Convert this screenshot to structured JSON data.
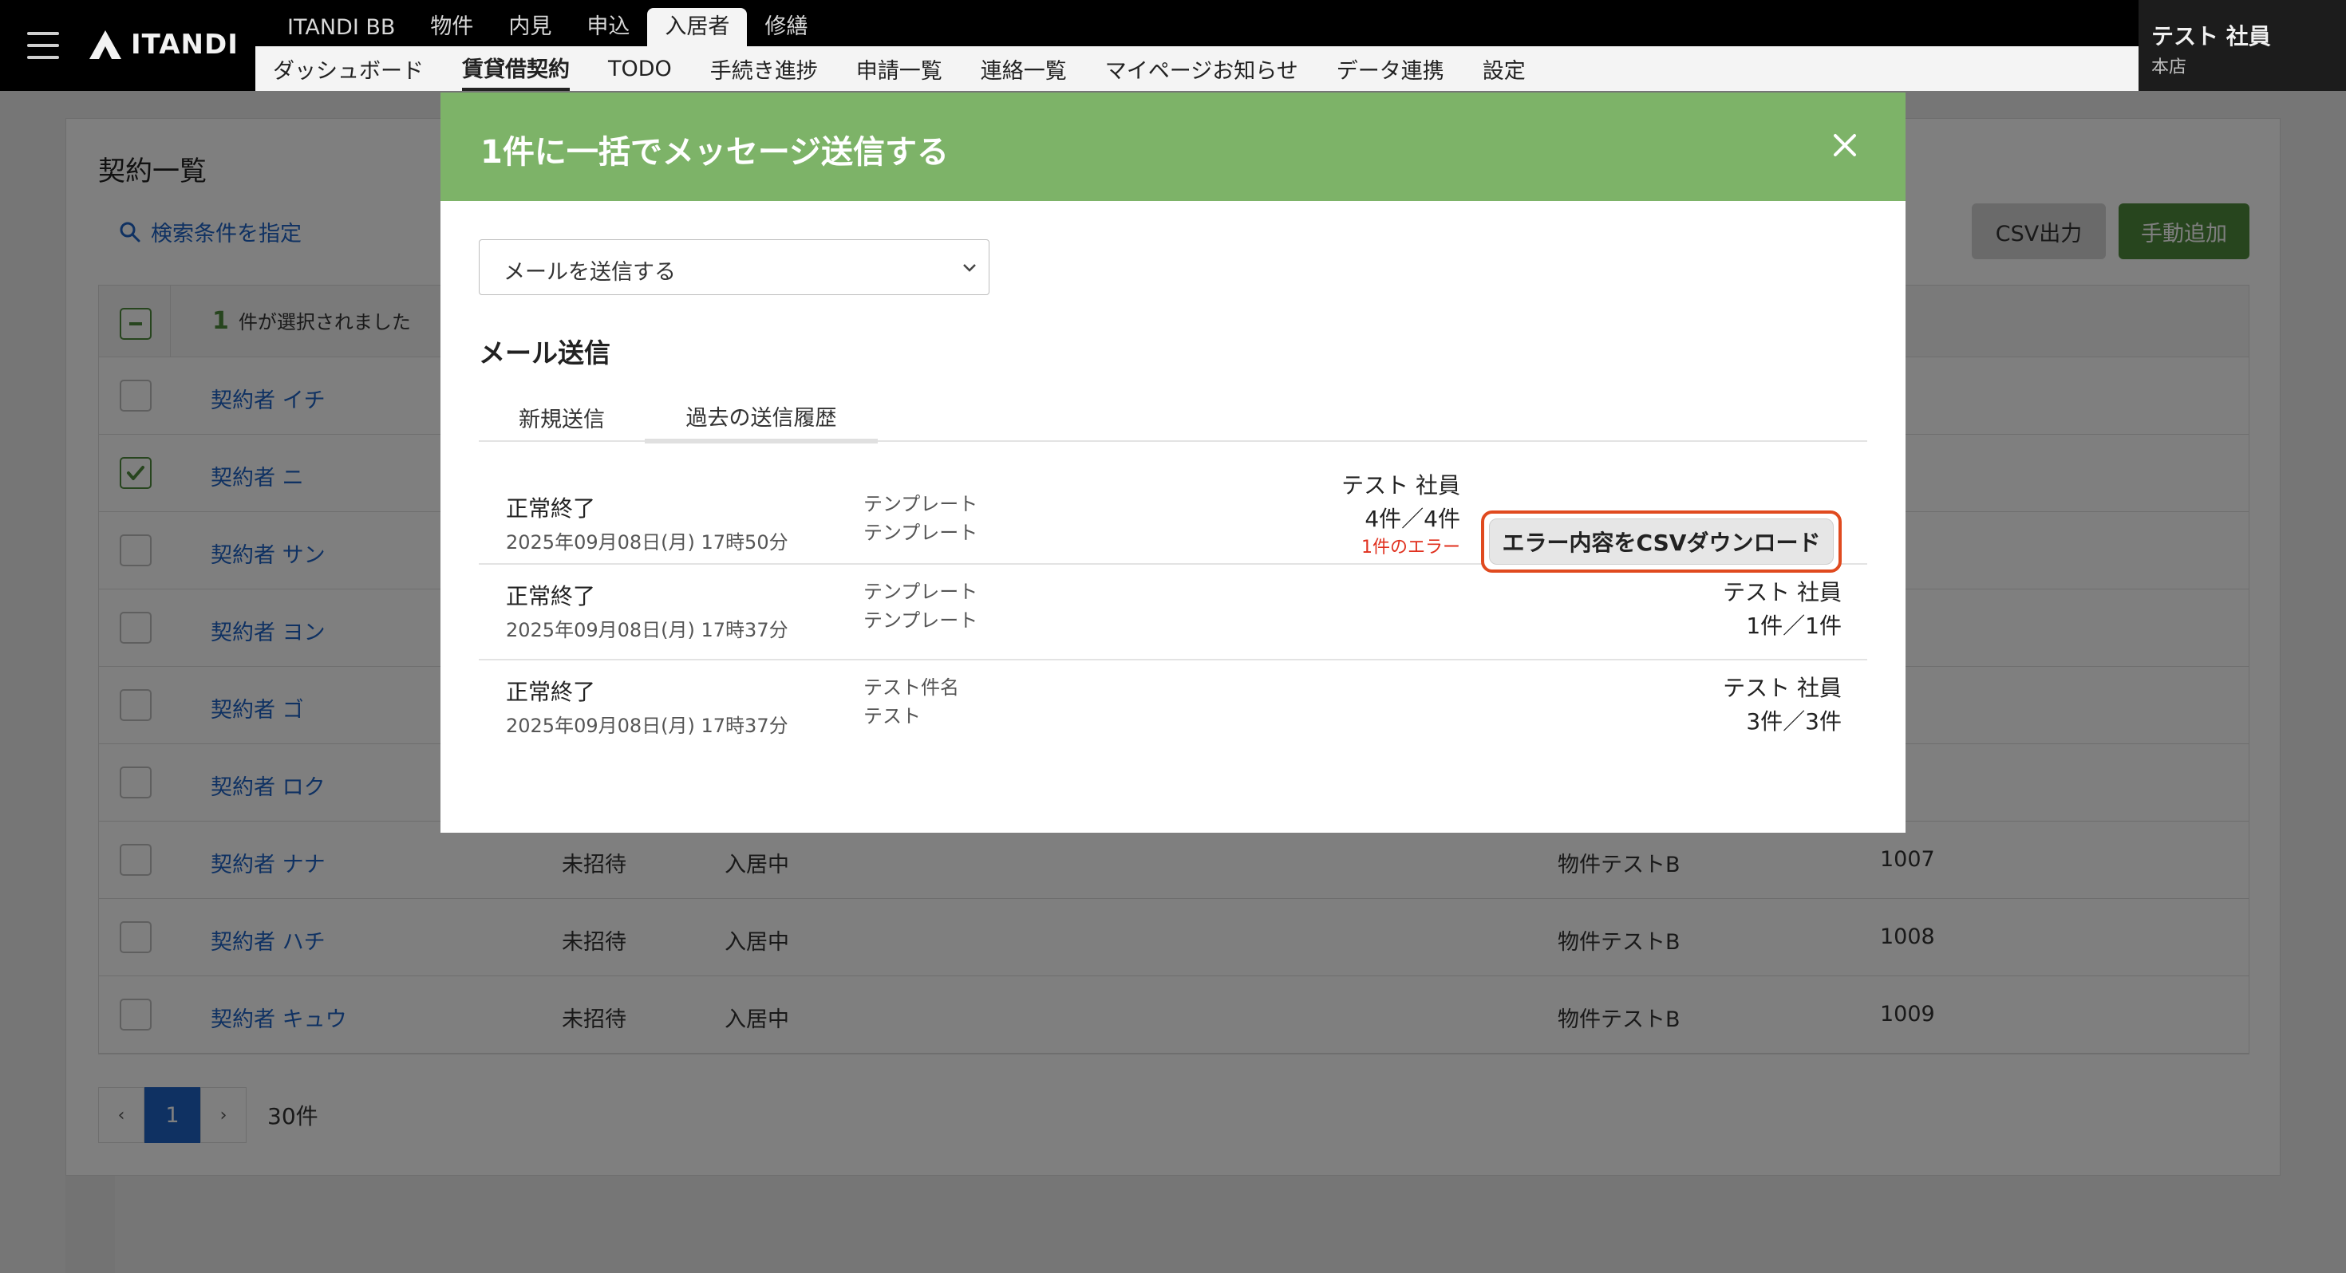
{
  "header": {
    "brand": "ITANDI",
    "top_nav": [
      "ITANDI BB",
      "物件",
      "内見",
      "申込",
      "入居者",
      "修繕"
    ],
    "sub_nav": [
      "ダッシュボード",
      "賃貸借契約",
      "TODO",
      "手続き進捗",
      "申請一覧",
      "連絡一覧",
      "マイページお知らせ",
      "データ連携",
      "設定"
    ],
    "user_name": "テスト 社員",
    "user_branch": "本店"
  },
  "page": {
    "title": "契約一覧",
    "search_link": "検索条件を指定",
    "csv_button": "CSV出力",
    "add_button": "手動追加",
    "selected_count": "1",
    "selected_text": "件が選択されました",
    "rows": [
      {
        "name": "契約者 イチ",
        "c1": "",
        "c2": "",
        "c3": "",
        "c4": "",
        "checked": false
      },
      {
        "name": "契約者 ニ",
        "c1": "",
        "c2": "",
        "c3": "",
        "c4": "",
        "checked": true
      },
      {
        "name": "契約者 サン",
        "c1": "",
        "c2": "",
        "c3": "",
        "c4": "",
        "checked": false
      },
      {
        "name": "契約者 ヨン",
        "c1": "",
        "c2": "",
        "c3": "",
        "c4": "",
        "checked": false
      },
      {
        "name": "契約者 ゴ",
        "c1": "",
        "c2": "",
        "c3": "",
        "c4": "",
        "checked": false
      },
      {
        "name": "契約者 ロク",
        "c1": "",
        "c2": "",
        "c3": "",
        "c4": "",
        "checked": false
      },
      {
        "name": "契約者 ナナ",
        "c1": "未招待",
        "c2": "入居中",
        "c3": "物件テストB",
        "c4": "1007",
        "checked": false
      },
      {
        "name": "契約者 ハチ",
        "c1": "未招待",
        "c2": "入居中",
        "c3": "物件テストB",
        "c4": "1008",
        "checked": false
      },
      {
        "name": "契約者 キュウ",
        "c1": "未招待",
        "c2": "入居中",
        "c3": "物件テストB",
        "c4": "1009",
        "checked": false
      }
    ],
    "pagination": {
      "prev": "‹",
      "current": "1",
      "next": "›",
      "total": "30件"
    }
  },
  "modal": {
    "title": "1件に一括でメッセージ送信する",
    "select_value": "メールを送信する",
    "section_title": "メール送信",
    "tabs": [
      "新規送信",
      "過去の送信履歴"
    ],
    "history": [
      {
        "status": "正常終了",
        "date": "2025年09月08日(月) 17時50分",
        "template_line1": "テンプレート",
        "template_line2": "テンプレート",
        "sender": "テスト 社員",
        "count": "4件／4件",
        "error": "1件のエラー",
        "button": "エラー内容をCSVダウンロード"
      },
      {
        "status": "正常終了",
        "date": "2025年09月08日(月) 17時37分",
        "template_line1": "テンプレート",
        "template_line2": "テンプレート",
        "sender": "テスト 社員",
        "count": "1件／1件"
      },
      {
        "status": "正常終了",
        "date": "2025年09月08日(月) 17時37分",
        "template_line1": "テスト件名",
        "template_line2": "テスト",
        "sender": "テスト 社員",
        "count": "3件／3件"
      }
    ]
  },
  "colors": {
    "modal_header": "#7db368",
    "link": "#1e63c4",
    "primary_green": "#4f8a3c",
    "error_red": "#e0301e",
    "highlight_outline": "#e04a1f"
  },
  "icons": [
    "hamburger-icon",
    "itandi-logo-icon",
    "search-icon",
    "close-icon",
    "chevron-down-icon",
    "checkbox-check-icon",
    "checkbox-indeterminate-icon"
  ]
}
